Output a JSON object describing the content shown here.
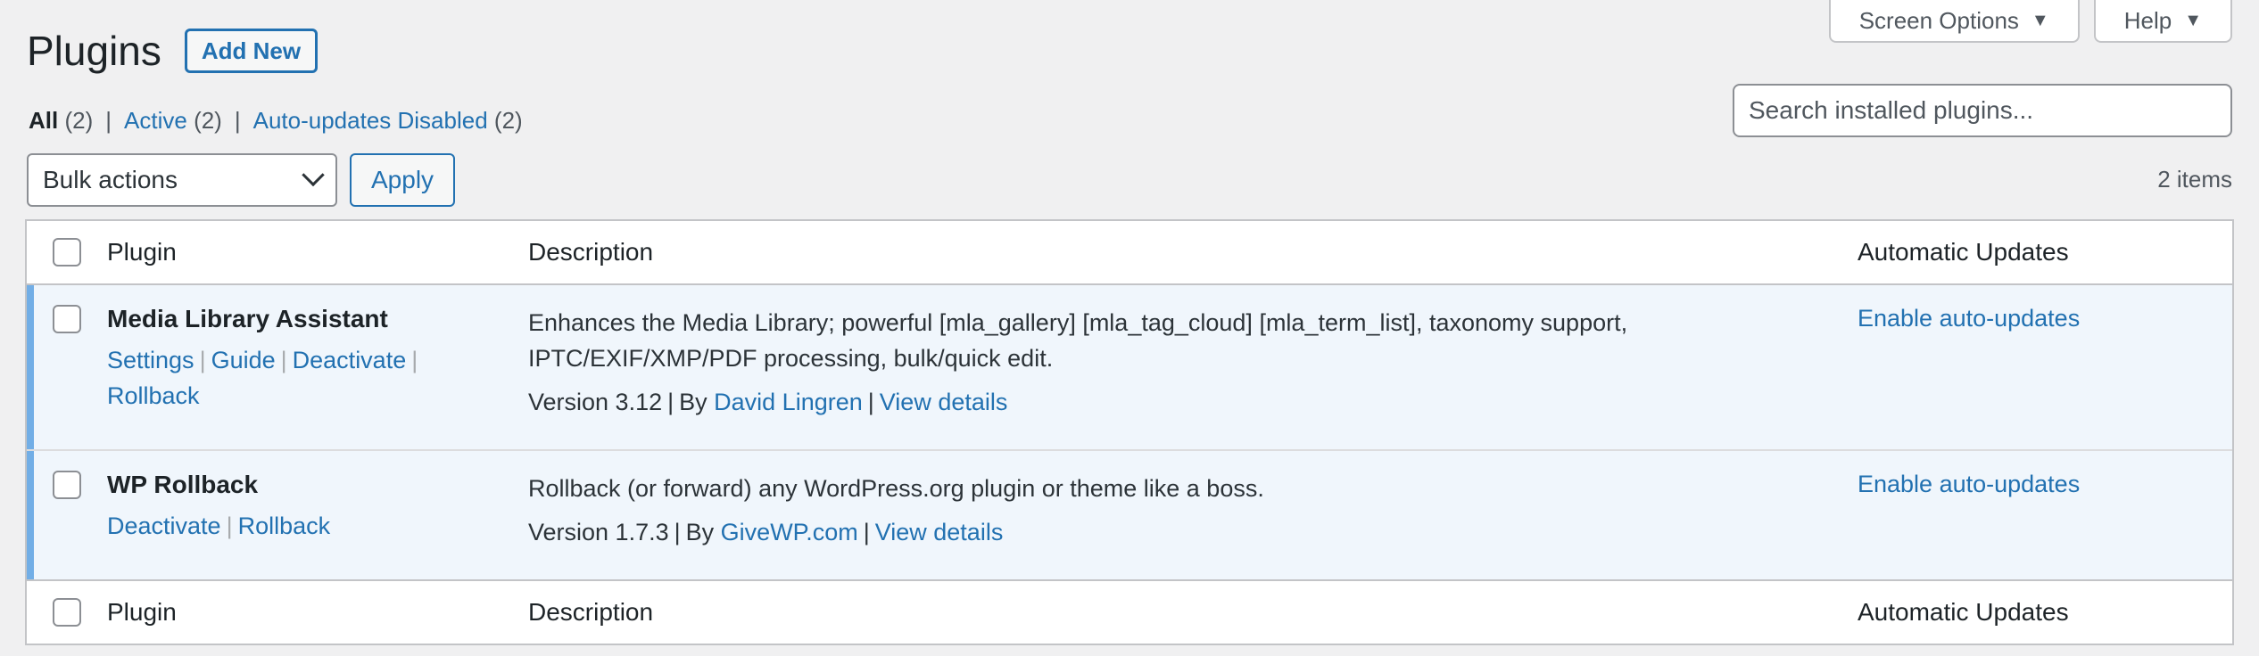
{
  "screen_meta": {
    "screen_options_label": "Screen Options",
    "help_label": "Help"
  },
  "header": {
    "title": "Plugins",
    "add_new_label": "Add New"
  },
  "filters": {
    "all_label": "All",
    "all_count": "(2)",
    "active_label": "Active",
    "active_count": "(2)",
    "auto_disabled_label": "Auto-updates Disabled",
    "auto_disabled_count": "(2)",
    "separator": "|"
  },
  "search": {
    "placeholder": "Search installed plugins..."
  },
  "bulk": {
    "selected": "Bulk actions",
    "apply_label": "Apply",
    "items_count": "2 items"
  },
  "table": {
    "columns": {
      "plugin": "Plugin",
      "description": "Description",
      "auto_updates": "Automatic Updates"
    },
    "rows": [
      {
        "name": "Media Library Assistant",
        "actions": [
          "Settings",
          "Guide",
          "Deactivate",
          "Rollback"
        ],
        "description": "Enhances the Media Library; powerful [mla_gallery] [mla_tag_cloud] [mla_term_list], taxonomy support, IPTC/EXIF/XMP/PDF processing, bulk/quick edit.",
        "version": "Version 3.12",
        "by": "By",
        "author": "David Lingren",
        "view_details": "View details",
        "auto_update": "Enable auto-updates"
      },
      {
        "name": "WP Rollback",
        "actions": [
          "Deactivate",
          "Rollback"
        ],
        "description": "Rollback (or forward) any WordPress.org plugin or theme like a boss.",
        "version": "Version 1.7.3",
        "by": "By",
        "author": "GiveWP.com",
        "view_details": "View details",
        "auto_update": "Enable auto-updates"
      }
    ]
  },
  "colors": {
    "link": "#2271b1",
    "active_row_bg": "#f0f6fc",
    "active_row_border": "#72aee6"
  }
}
